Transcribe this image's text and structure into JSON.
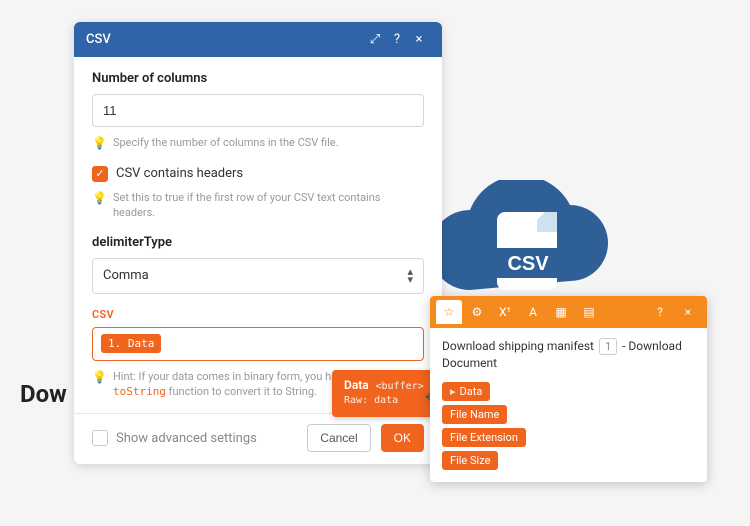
{
  "background": {
    "text": "Dow"
  },
  "dialog": {
    "title": "CSV",
    "numberOfColumns": {
      "label": "Number of columns",
      "value": "11",
      "hint": "Specify the number of columns in the CSV file."
    },
    "containsHeaders": {
      "label": "CSV contains headers",
      "checked": true,
      "hint": "Set this to true if the first row of your CSV text contains headers."
    },
    "delimiter": {
      "label": "delimiterType",
      "value": "Comma"
    },
    "csvField": {
      "label": "CSV",
      "chip": "1. Data",
      "hintPrefix": "Hint: If your data comes in binary form, you ",
      "hintMiddle": "have to use the",
      "hintCode": "toString",
      "hintSuffix": " function to convert it to String."
    },
    "advanced": {
      "label": "Show advanced settings",
      "checked": false
    },
    "buttons": {
      "cancel": "Cancel",
      "ok": "OK"
    }
  },
  "tooltip": {
    "title": "Data",
    "type": "<buffer>",
    "raw": "Raw: data"
  },
  "popup": {
    "titleA": "Download shipping manifest",
    "index": "1",
    "titleB": "- Download Document",
    "outputs": [
      "Data",
      "File Name",
      "File Extension",
      "File Size"
    ],
    "help": "?",
    "close": "×"
  },
  "icons": {
    "expand": "⤢",
    "help": "?",
    "close": "×",
    "bulb": "💡",
    "check": "✓",
    "star": "☆",
    "gear": "⚙",
    "xsup": "X¹",
    "textA": "A",
    "calendar": "▦",
    "table": "▤",
    "move": "✥"
  }
}
